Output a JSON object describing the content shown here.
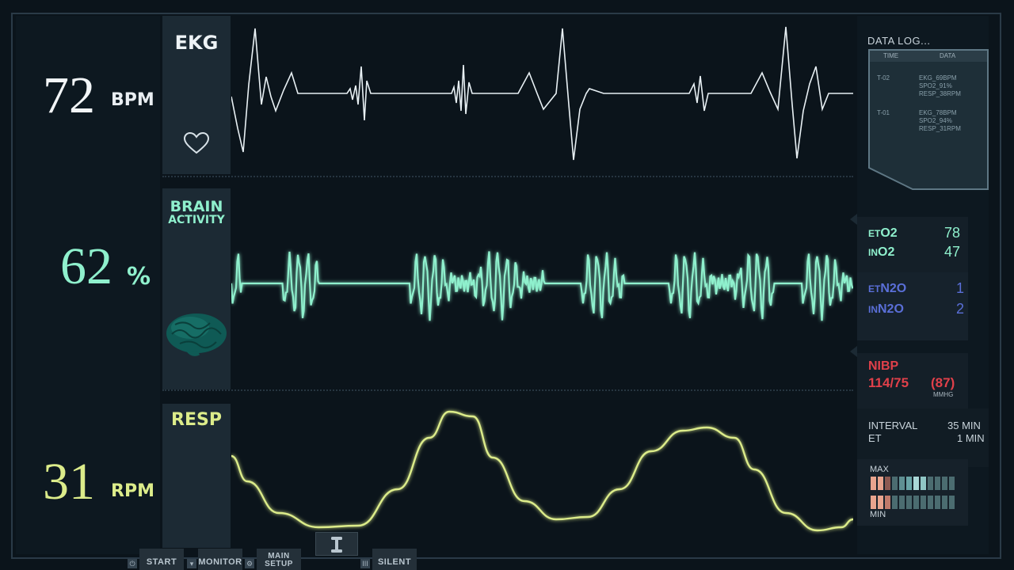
{
  "vitals": {
    "heart": {
      "value": "72",
      "unit": "BPM"
    },
    "brain": {
      "value": "62",
      "unit": "%"
    },
    "resp": {
      "value": "31",
      "unit": "RPM"
    }
  },
  "channels": {
    "ekg": {
      "label": "EKG"
    },
    "brain": {
      "label_1": "BRAIN",
      "label_2": "ACTIVITY"
    },
    "resp": {
      "label": "RESP"
    }
  },
  "data_log": {
    "title": "DATA LOG...",
    "col_time": "TIME",
    "col_data": "DATA",
    "entries": [
      {
        "time": "T-02",
        "lines": [
          "EKG_69BPM",
          "SPO2_91%",
          "RESP_38RPM"
        ]
      },
      {
        "time": "T-01",
        "lines": [
          "EKG_78BPM",
          "SPO2_94%",
          "RESP_31RPM"
        ]
      }
    ]
  },
  "gases": {
    "et_o2": {
      "prefix": "ET",
      "gas": "O2",
      "value": "78"
    },
    "in_o2": {
      "prefix": "IN",
      "gas": "O2",
      "value": "47"
    },
    "et_n2o": {
      "prefix": "ET",
      "gas": "N2O",
      "value": "1"
    },
    "in_n2o": {
      "prefix": "IN",
      "gas": "N2O",
      "value": "2"
    }
  },
  "nibp": {
    "label": "NIBP",
    "value": "114/75",
    "mean": "(87)",
    "unit": "MMHG"
  },
  "interval": {
    "label": "INTERVAL",
    "value": "35 MIN",
    "et_label": "ET",
    "et_value": "1 MIN"
  },
  "range": {
    "max_label": "MAX",
    "min_label": "MIN"
  },
  "buttons": {
    "start": "START",
    "monitor": "MONITOR",
    "main_1": "MAIN",
    "main_2": "SETUP",
    "silent": "SILENT"
  },
  "colors": {
    "ekg": "#e8f0f4",
    "brain": "#8ff0cd",
    "resp": "#dcec8a",
    "nibp": "#e0404a",
    "n2o": "#5a6fd8",
    "o2": "#8ff0cd"
  }
}
